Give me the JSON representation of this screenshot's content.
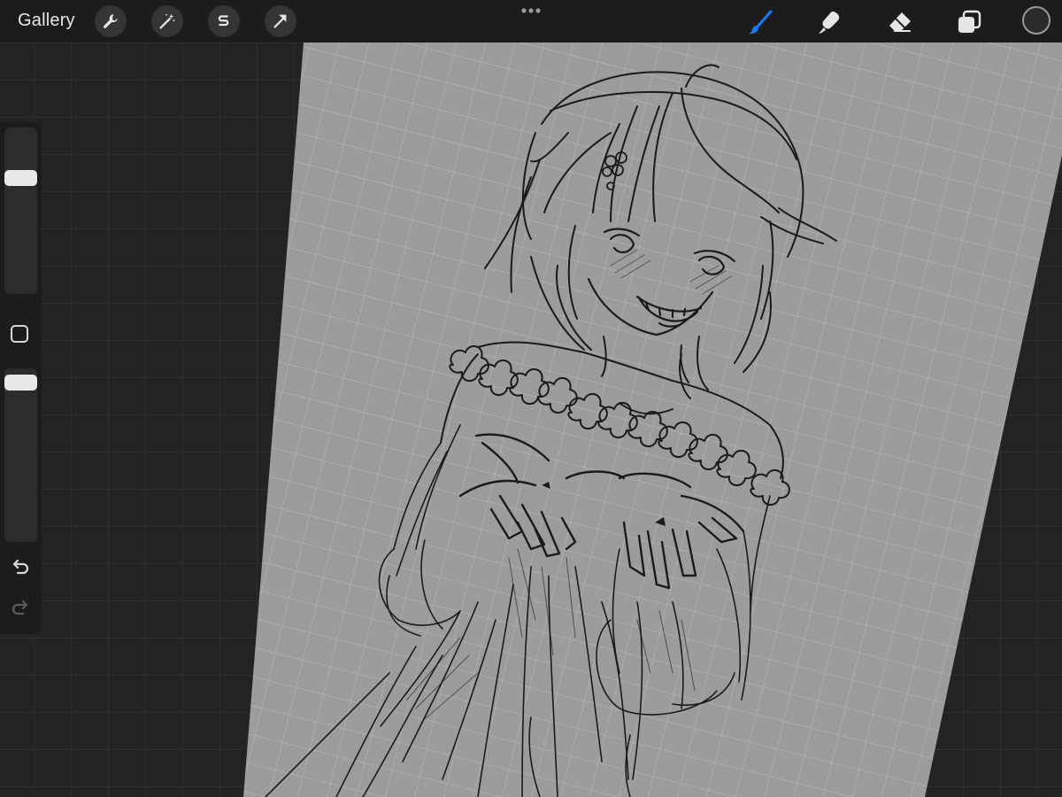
{
  "top_bar": {
    "gallery_label": "Gallery",
    "left_tools": [
      "wrench-icon",
      "magic-wand-icon",
      "selection-s-icon",
      "transform-arrow-icon"
    ],
    "right_tools": [
      "brush-icon",
      "smudge-icon",
      "eraser-icon",
      "layers-icon"
    ],
    "active_tool": "brush-icon",
    "current_color": "#2a2a2a"
  },
  "side_bar": {
    "brush_size_level": 0.72,
    "brush_opacity_level": 0.96,
    "undo_icon": "undo-icon",
    "redo_icon": "redo-icon",
    "modify_icon": "square-modify-icon"
  },
  "colors": {
    "accent": "#1a7cf5",
    "canvas_paper": "#9c9c9c",
    "canvas_grid": "#b4b4b4",
    "workspace": "#232323",
    "toolbar": "#1c1c1e"
  }
}
